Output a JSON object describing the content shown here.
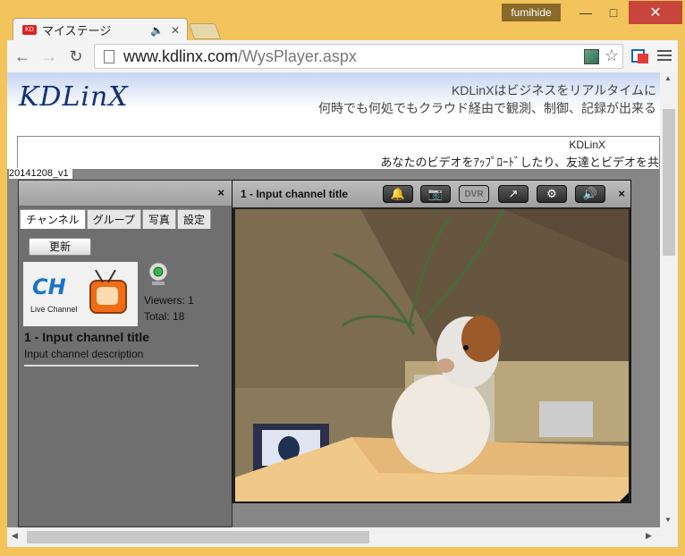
{
  "browser": {
    "user": "fumihide",
    "tab": {
      "title": "マイステージ",
      "favicon": "KD",
      "audio_icon": "speaker-icon"
    },
    "url": {
      "host": "www.kdlinx.com",
      "path": "/WysPlayer.aspx"
    }
  },
  "page": {
    "logo": "KDLinX",
    "tagline1": "KDLinXはビジネスをリアルタイムに",
    "tagline2": "何時でも何処でもクラウド経由で観測、制御、記録が出来る",
    "banner_title": "KDLinX",
    "banner_text": "あなたのビデオをｱｯﾌﾟﾛｰﾄﾞしたり、友達とビデオを共",
    "version": "20141208_v1"
  },
  "channel_panel": {
    "close": "×",
    "tabs": [
      "チャンネル",
      "グループ",
      "写真",
      "設定"
    ],
    "refresh_label": "更新",
    "channel": {
      "logo_text": "CH",
      "logo_sub": "Live Channel",
      "viewers": "Viewers: 1",
      "total": "Total: 18",
      "name": "1 - Input channel title",
      "description": "Input channel description"
    }
  },
  "player": {
    "title": "1 - Input channel title",
    "buttons": {
      "bell": "bell-icon",
      "camera": "camera-icon",
      "dvr": "DVR",
      "fullscreen": "fullscreen-icon",
      "settings": "gear-icon",
      "volume": "volume-icon"
    },
    "close": "×"
  },
  "colors": {
    "accent_red": "#c7453a",
    "frame": "#f3c45c",
    "logo_blue": "#152f7a"
  }
}
